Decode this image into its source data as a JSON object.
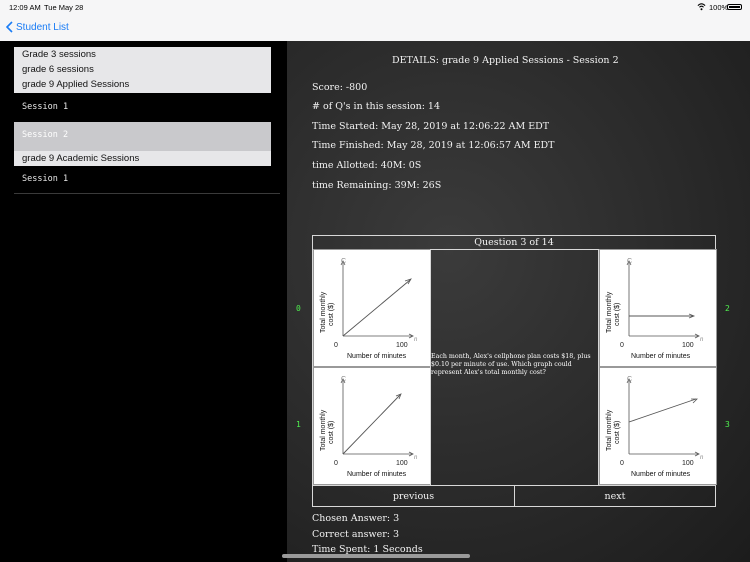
{
  "status_bar": {
    "time": "12:09 AM",
    "date": "Tue May 28",
    "battery": "100%"
  },
  "nav": {
    "back_label": "Student List"
  },
  "sidebar": {
    "items": [
      {
        "label": "Grade 3 sessions"
      },
      {
        "label": "grade 6 sessions"
      },
      {
        "label": "grade 9 Applied Sessions"
      },
      {
        "label": "Session 1"
      },
      {
        "label": "Session 2"
      },
      {
        "label": "grade 9 Academic Sessions"
      },
      {
        "label": "Session 1"
      }
    ]
  },
  "details": {
    "title": "DETAILS: grade 9 Applied Sessions - Session 2",
    "score": "Score: -800",
    "num_questions": "# of Q's in this session: 14",
    "time_started": "Time Started: May 28, 2019 at 12:06:22 AM EDT",
    "time_finished": "Time Finished: May 28, 2019 at 12:06:57 AM EDT",
    "time_allotted": "time Allotted: 40M: 0S",
    "time_remaining": "time Remaining: 39M: 26S"
  },
  "question": {
    "title": "Question 3 of 14",
    "text": "Each month, Alex's cellphone plan costs $18, plus $0.10 per minute of use. Which graph could represent Alex's total monthly cost?",
    "option_numbers": [
      "0",
      "1",
      "2",
      "3"
    ],
    "graph": {
      "y_label_1": "Total monthly",
      "y_label_2": "cost ($)",
      "x_label": "Number of minutes",
      "y_axis_var": "C",
      "x_axis_var": "n",
      "origin": "0",
      "x_tick": "100"
    },
    "previous_label": "previous",
    "next_label": "next"
  },
  "results": {
    "chosen": "Chosen Answer: 3",
    "correct": "Correct answer: 3",
    "time_spent": "Time Spent: 1 Seconds"
  }
}
